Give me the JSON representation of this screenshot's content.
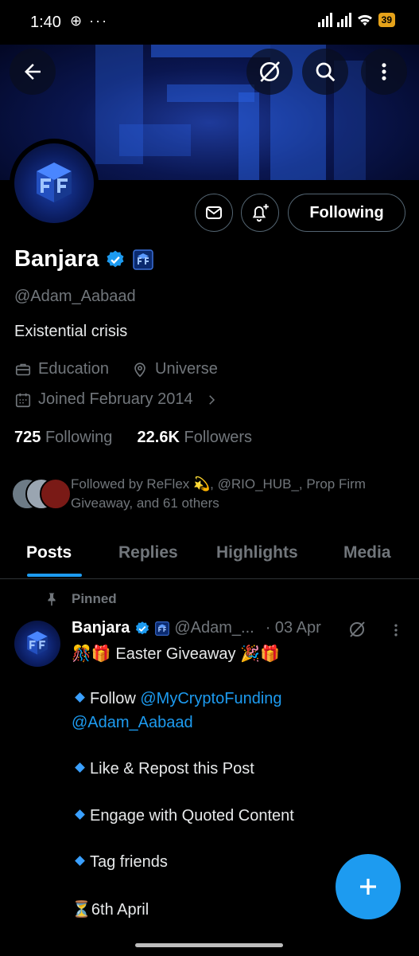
{
  "status_bar": {
    "time": "1:40",
    "extra_icons": "⊕ ···",
    "battery": "39"
  },
  "header": {
    "back_icon": "arrow-left-icon",
    "grok_icon": "grok-icon",
    "search_icon": "search-icon",
    "more_icon": "more-vertical-icon"
  },
  "profile": {
    "name": "Banjara",
    "handle": "@Adam_Aabaad",
    "bio": "Existential crisis",
    "category": "Education",
    "location": "Universe",
    "joined": "Joined February 2014",
    "following_count": "725",
    "following_label": "Following",
    "followers_count": "22.6K",
    "followers_label": "Followers",
    "followed_by": "Followed by ReFlex 💫, @RIO_HUB_, Prop Firm Giveaway, and 61 others",
    "follow_button": "Following",
    "accent": "#1d9bf0"
  },
  "tabs": [
    {
      "label": "Posts",
      "active": true
    },
    {
      "label": "Replies",
      "active": false
    },
    {
      "label": "Highlights",
      "active": false
    },
    {
      "label": "Media",
      "active": false
    }
  ],
  "pinned_post": {
    "pinned_label": "Pinned",
    "author": "Banjara",
    "handle": "@Adam_...",
    "date": "· 03 Apr",
    "line1": "🎊🎁 Easter Giveaway 🎉🎁",
    "follow_prefix": "Follow ",
    "follow_link": "@MyCryptoFunding",
    "follow_link2": "@Adam_Aabaad",
    "item2": "Like & Repost this Post",
    "item3": "Engage with Quoted Content",
    "item4": "Tag friends",
    "deadline": "⏳6th April"
  }
}
